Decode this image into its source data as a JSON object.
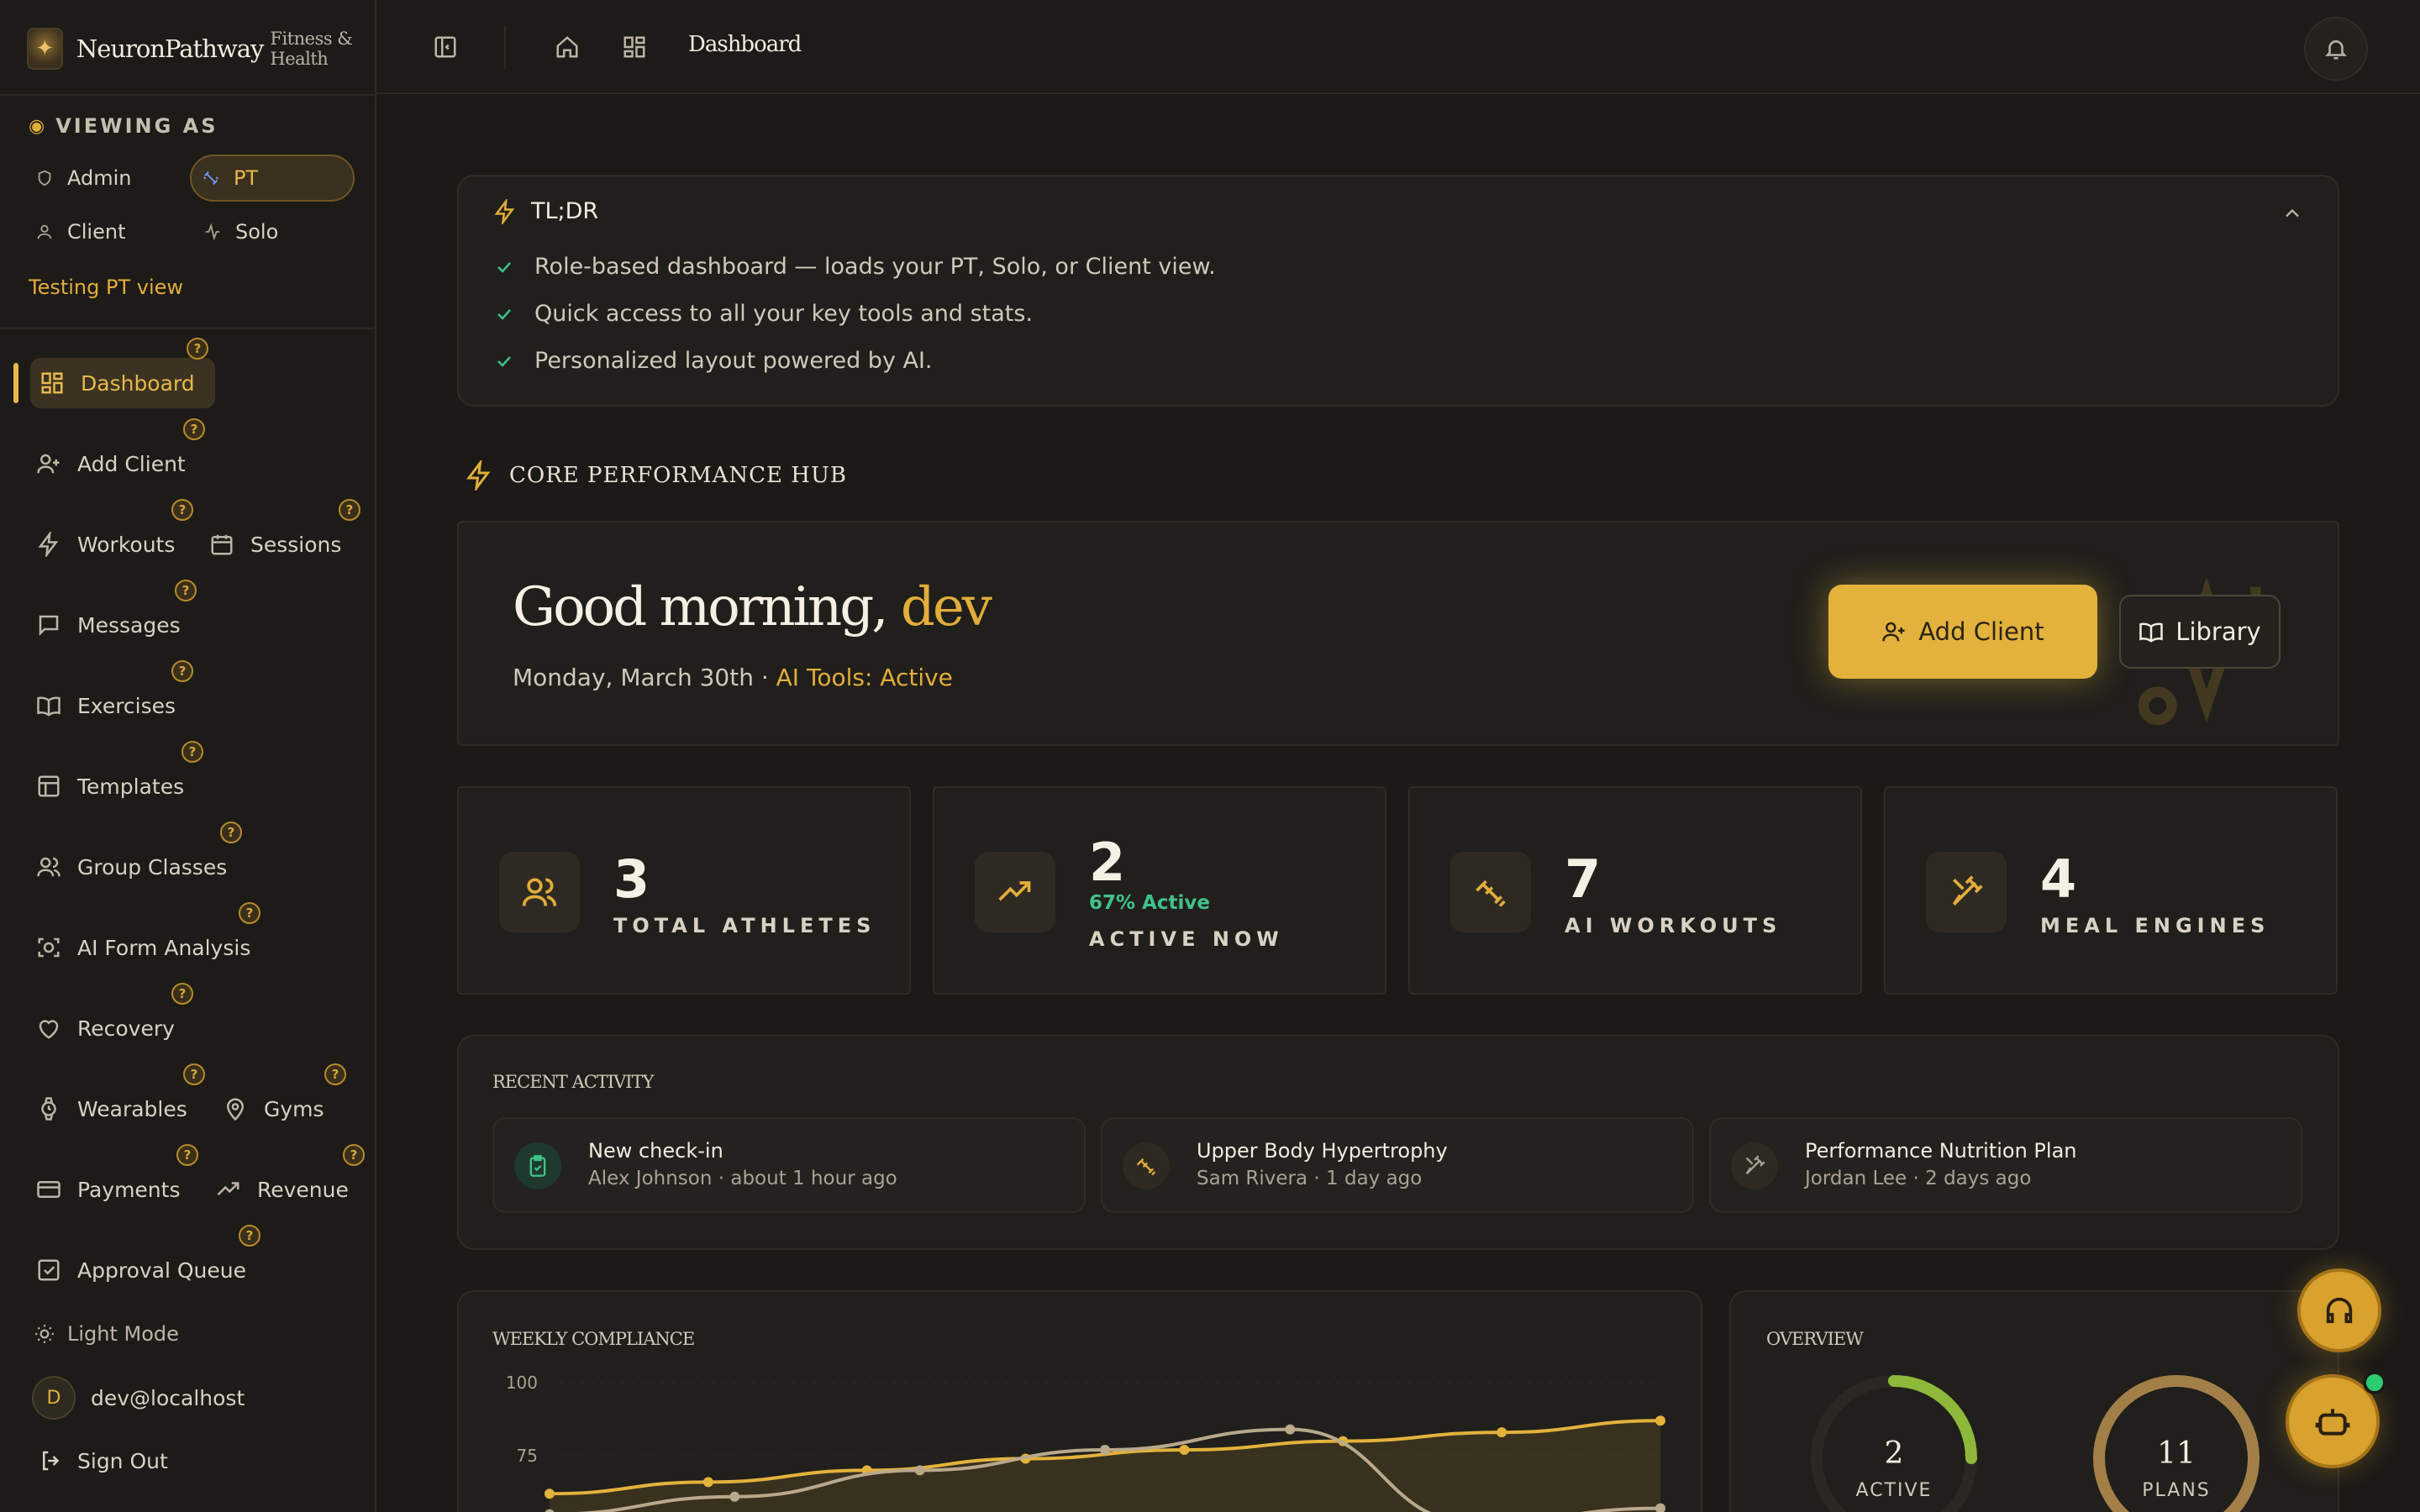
{
  "brand": {
    "name": "NeuronPathway",
    "sub": "Fitness & Health"
  },
  "viewing_as": {
    "label": "VIEWING AS",
    "roles": [
      {
        "label": "Admin",
        "icon": "shield-icon"
      },
      {
        "label": "PT",
        "icon": "dumbbell-icon",
        "active": true
      },
      {
        "label": "Client",
        "icon": "user-icon"
      },
      {
        "label": "Solo",
        "icon": "activity-icon"
      }
    ],
    "testing_text": "Testing PT view"
  },
  "nav": {
    "items": [
      {
        "label": "Dashboard",
        "icon": "dashboard-icon",
        "active": true
      },
      {
        "label": "Add Client",
        "icon": "user-plus-icon"
      },
      {
        "label": "Workouts",
        "icon": "bolt-icon"
      },
      {
        "label": "Sessions",
        "icon": "calendar-icon"
      },
      {
        "label": "Messages",
        "icon": "message-icon"
      },
      {
        "label": "Exercises",
        "icon": "book-icon"
      },
      {
        "label": "Templates",
        "icon": "template-icon"
      },
      {
        "label": "Group Classes",
        "icon": "users-icon"
      },
      {
        "label": "AI Form Analysis",
        "icon": "scan-icon"
      },
      {
        "label": "Recovery",
        "icon": "heart-icon"
      },
      {
        "label": "Wearables",
        "icon": "watch-icon"
      },
      {
        "label": "Gyms",
        "icon": "map-pin-icon"
      },
      {
        "label": "Payments",
        "icon": "credit-card-icon"
      },
      {
        "label": "Revenue",
        "icon": "trending-up-icon"
      },
      {
        "label": "Approval Queue",
        "icon": "check-square-icon"
      }
    ],
    "help_glyph": "?"
  },
  "footer": {
    "light_mode": "Light Mode",
    "user_initial": "D",
    "user_email": "dev@localhost",
    "sign_out": "Sign Out"
  },
  "topbar": {
    "breadcrumb": "Dashboard"
  },
  "tldr": {
    "title": "TL;DR",
    "lines": [
      "Role-based dashboard — loads your PT, Solo, or Client view.",
      "Quick access to all your key tools and stats.",
      "Personalized layout powered by AI."
    ]
  },
  "hub": {
    "title": "CORE PERFORMANCE HUB",
    "greeting_prefix": "Good morning, ",
    "greeting_name": "dev",
    "date_text": "Monday, March 30th · ",
    "ai_status": "AI Tools: Active",
    "add_client_label": "Add Client",
    "library_label": "Library"
  },
  "stats": [
    {
      "value": "3",
      "label": "TOTAL ATHLETES",
      "icon": "users-icon"
    },
    {
      "value": "2",
      "sub": "67% Active",
      "label": "ACTIVE NOW",
      "icon": "trending-up-icon"
    },
    {
      "value": "7",
      "label": "AI WORKOUTS",
      "icon": "dumbbell-icon"
    },
    {
      "value": "4",
      "label": "MEAL ENGINES",
      "icon": "utensils-icon"
    }
  ],
  "recent_activity": {
    "title": "RECENT ACTIVITY",
    "items": [
      {
        "title": "New check-in",
        "meta": "Alex Johnson · about 1 hour ago",
        "icon": "clipboard-check-icon"
      },
      {
        "title": "Upper Body Hypertrophy",
        "meta": "Sam Rivera · 1 day ago",
        "icon": "dumbbell-icon"
      },
      {
        "title": "Performance Nutrition Plan",
        "meta": "Jordan Lee · 2 days ago",
        "icon": "utensils-icon"
      }
    ]
  },
  "weekly_compliance": {
    "title": "WEEKLY COMPLIANCE"
  },
  "overview": {
    "title": "OVERVIEW",
    "active_value": "2",
    "active_label": "ACTIVE",
    "plans_value": "11",
    "plans_label": "PLANS"
  },
  "chart_data": {
    "type": "line",
    "title": "WEEKLY COMPLIANCE",
    "yticks": [
      100,
      75
    ],
    "ylim": [
      0,
      100
    ],
    "series": [
      {
        "values": [
          62,
          66,
          70,
          74,
          77,
          80,
          83,
          87
        ],
        "color": "#e3b23c"
      },
      {
        "values": [
          55,
          61,
          70,
          77,
          84,
          52,
          57
        ],
        "color": "#b8a88c"
      }
    ]
  }
}
